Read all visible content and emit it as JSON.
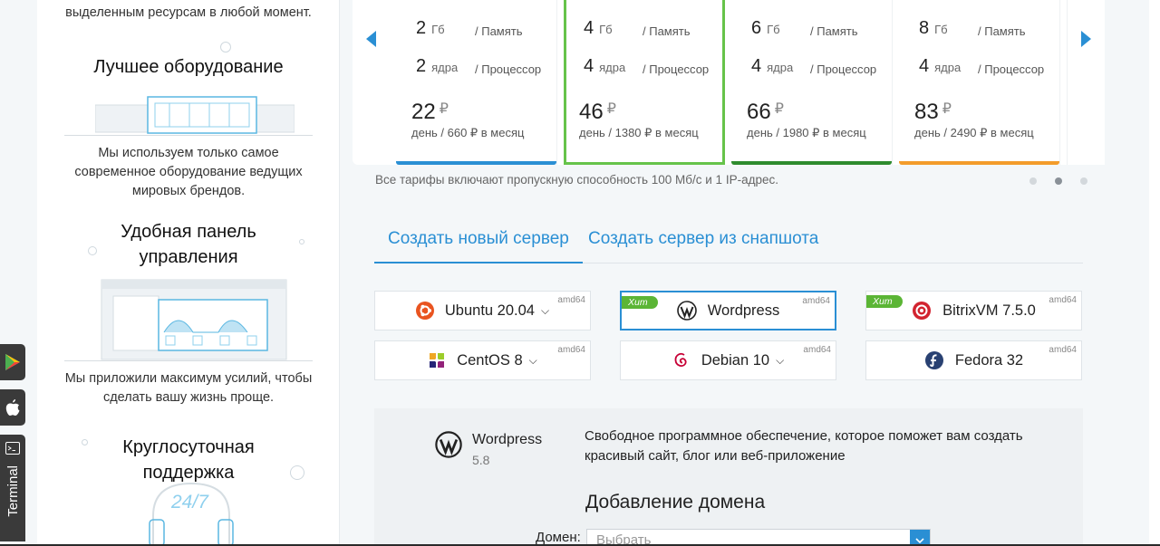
{
  "features": [
    {
      "title": "",
      "text": [
        "выделенным ресурсам в любой момент."
      ]
    },
    {
      "title": "Лучшее оборудование",
      "text": [
        "Мы используем только самое",
        "современное оборудование ведущих",
        "мировых брендов."
      ]
    },
    {
      "title": [
        "Удобная панель",
        "управления"
      ],
      "text": [
        "Мы приложили максимум усилий, чтобы",
        "сделать вашу жизнь проще."
      ]
    },
    {
      "title": [
        "Круглосуточная",
        "поддержка"
      ],
      "badge": "24/7"
    }
  ],
  "plans": [
    {
      "ram": "2",
      "ram_unit": "Гб",
      "ram_label": "/ Память",
      "cpu": "2",
      "cpu_unit": "ядра",
      "cpu_label": "/ Процессор",
      "price": "22",
      "currency": "₽",
      "sub": "день / 660 ₽ в месяц",
      "accent": "#2a8fd4"
    },
    {
      "ram": "4",
      "ram_unit": "Гб",
      "ram_label": "/ Память",
      "cpu": "4",
      "cpu_unit": "ядра",
      "cpu_label": "/ Процессор",
      "price": "46",
      "currency": "₽",
      "sub": "день / 1380 ₽ в месяц",
      "accent": "#66c34a"
    },
    {
      "ram": "6",
      "ram_unit": "Гб",
      "ram_label": "/ Память",
      "cpu": "4",
      "cpu_unit": "ядра",
      "cpu_label": "/ Процессор",
      "price": "66",
      "currency": "₽",
      "sub": "день / 1980 ₽ в месяц",
      "accent": "#2e8b2e"
    },
    {
      "ram": "8",
      "ram_unit": "Гб",
      "ram_label": "/ Память",
      "cpu": "4",
      "cpu_unit": "ядра",
      "cpu_label": "/ Процессор",
      "price": "83",
      "currency": "₽",
      "sub": "день / 2490 ₽ в месяц",
      "accent": "#f39c2b"
    }
  ],
  "plans_note": "Все тарифы включают пропускную способность 100 Мб/с и 1 IP-адрес.",
  "tabs": [
    "Создать новый сервер",
    "Создать сервер из снапшота"
  ],
  "os_list": [
    {
      "name": "Ubuntu 20.04",
      "arch": "amd64",
      "dropdown": true,
      "hit": "",
      "icon": "ubuntu-icon"
    },
    {
      "name": "Wordpress",
      "arch": "amd64",
      "dropdown": false,
      "hit": "Хит",
      "icon": "wordpress-icon"
    },
    {
      "name": "BitrixVM 7.5.0",
      "arch": "amd64",
      "dropdown": false,
      "hit": "Хит",
      "icon": "bitrix-icon"
    },
    {
      "name": "CentOS 8",
      "arch": "amd64",
      "dropdown": true,
      "hit": "",
      "icon": "centos-icon"
    },
    {
      "name": "Debian 10",
      "arch": "amd64",
      "dropdown": true,
      "hit": "",
      "icon": "debian-icon"
    },
    {
      "name": "Fedora 32",
      "arch": "amd64",
      "dropdown": false,
      "hit": "",
      "icon": "fedora-icon"
    }
  ],
  "details": {
    "name": "Wordpress",
    "version": "5.8",
    "description": "Свободное программное обеспечение, которое поможет вам создать красивый сайт, блог или веб-приложение",
    "section_title": "Добавление домена",
    "domain_label": "Домен:",
    "domain_placeholder": "Выбрать"
  },
  "dock": {
    "terminal_label": "Terminal"
  },
  "colors": {
    "accent": "#2a8fd4",
    "hit": "#5bb535",
    "selected_plan": "#66c34a"
  }
}
